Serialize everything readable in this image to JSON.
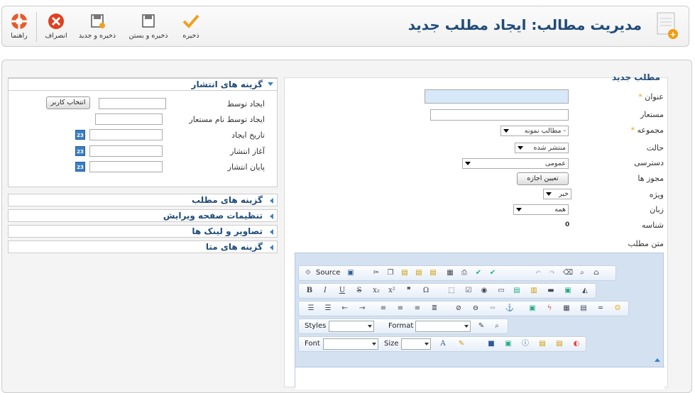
{
  "header": {
    "title": "مدیریت مطالب: ایجاد مطلب جدید",
    "toolbar": {
      "save": "ذخیره",
      "save_close": "ذخیره و بستن",
      "save_new": "ذخیره و جدید",
      "cancel": "انصراف",
      "help": "راهنما"
    }
  },
  "form": {
    "legend": "مطلب جدید",
    "title_label": "عنوان",
    "alias_label": "مستعار",
    "category_label": "مجموعه",
    "category_value": "- مطالب نمونه",
    "state_label": "حالت",
    "state_value": "منتشر شده",
    "access_label": "دسترسی",
    "access_value": "عمومی",
    "permissions_label": "مجوز ها",
    "permissions_button": "تعیین اجازه",
    "featured_label": "ویژه",
    "featured_value": "خیر",
    "language_label": "زبان",
    "language_value": "همه",
    "id_label": "شناسه",
    "id_value": "0",
    "text_label": "متن مطلب",
    "required_mark": "*"
  },
  "editor": {
    "source": "Source",
    "styles": "Styles",
    "format": "Format",
    "font": "Font",
    "size": "Size"
  },
  "publishing": {
    "header": "گزینه های انتشار",
    "created_by": "ایجاد توسط",
    "select_user": "انتخاب کاربر",
    "created_alias": "ایجاد توسط نام مستعار",
    "created_date": "تاریخ ایجاد",
    "publish_up": "آغاز انتشار",
    "publish_down": "پایان انتشار",
    "cal_day": "23"
  },
  "panels": [
    "گزینه های مطلب",
    "تنظیمات صفحه ویرایش",
    "تصاویر و لینک ها",
    "گزینه های متا"
  ],
  "colors": {
    "title": "#1f4b7a",
    "accent": "#3c7fc4",
    "required": "#e8a317"
  }
}
